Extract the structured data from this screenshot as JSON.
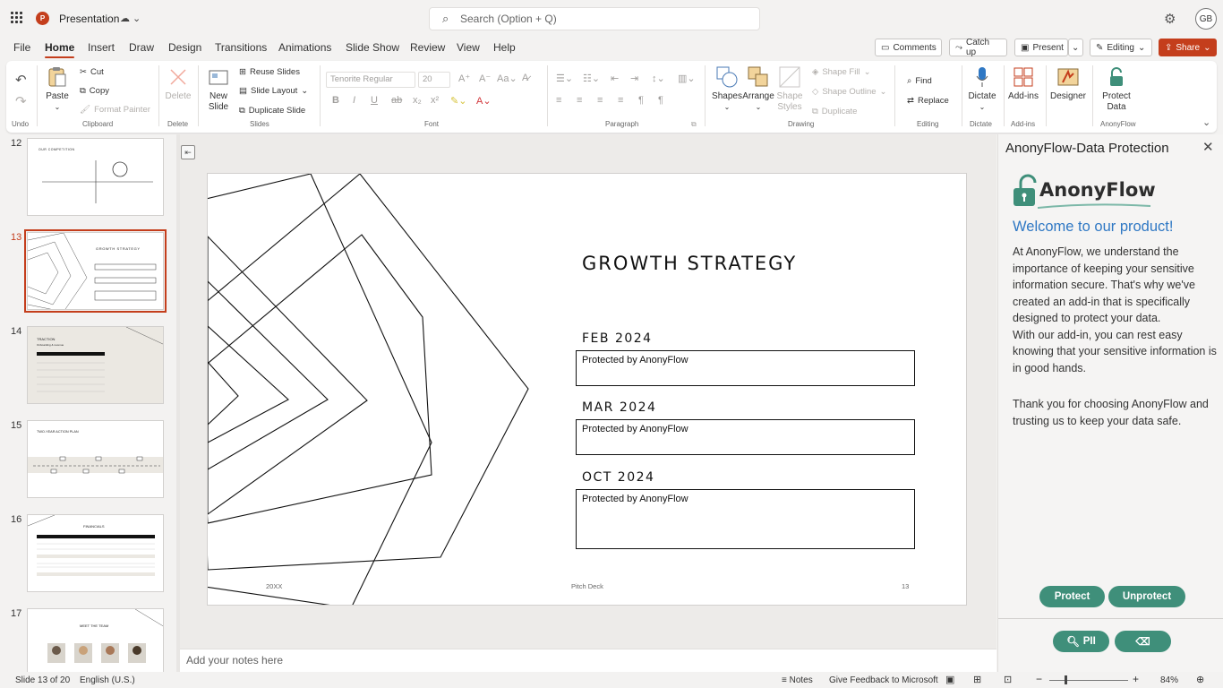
{
  "titlebar": {
    "app_icon_letter": "P",
    "doc_title": "Presentation",
    "sync_status": "☁︎ ⌄",
    "search_placeholder": "Search (Option + Q)",
    "user_initials": "GB"
  },
  "menu": {
    "tabs": [
      "File",
      "Home",
      "Insert",
      "Draw",
      "Design",
      "Transitions",
      "Animations",
      "Slide Show",
      "Review",
      "View",
      "Help"
    ],
    "active_tab": "Home",
    "comments": "Comments",
    "catch_up": "Catch up",
    "present": "Present",
    "editing": "Editing",
    "share": "Share"
  },
  "ribbon": {
    "undo_group": "Undo",
    "clipboard": {
      "paste": "Paste",
      "cut": "Cut",
      "copy": "Copy",
      "format_painter": "Format Painter",
      "label": "Clipboard"
    },
    "delete": {
      "delete": "Delete",
      "label": "Delete"
    },
    "slides": {
      "new_slide": "New Slide",
      "reuse": "Reuse Slides",
      "layout": "Slide Layout",
      "duplicate": "Duplicate Slide",
      "label": "Slides"
    },
    "font": {
      "name": "Tenorite Regular",
      "size": "20",
      "label": "Font"
    },
    "paragraph": {
      "label": "Paragraph"
    },
    "drawing": {
      "shapes": "Shapes",
      "arrange": "Arrange",
      "styles": "Shape Styles",
      "fill": "Shape Fill",
      "outline": "Shape Outline",
      "duplicate": "Duplicate",
      "label": "Drawing"
    },
    "editing": {
      "find": "Find",
      "replace": "Replace",
      "label": "Editing"
    },
    "dictate": {
      "dictate": "Dictate",
      "label": "Dictate"
    },
    "addins": {
      "addins": "Add-ins",
      "label": "Add-ins"
    },
    "designer": "Designer",
    "anonyflow": {
      "protect_data": "Protect Data",
      "label": "AnonyFlow"
    }
  },
  "slides_panel": {
    "thumbs": [
      {
        "num": "12",
        "title": "OUR COMPETITION"
      },
      {
        "num": "13",
        "title": "GROWTH STRATEGY"
      },
      {
        "num": "14",
        "title": "TRACTION",
        "subtitle": "Onboarding & revenue"
      },
      {
        "num": "15",
        "title": "TWO-YEAR ACTION PLAN"
      },
      {
        "num": "16",
        "title": "FINANCIALS"
      },
      {
        "num": "17",
        "title": "MEET THE TEAM"
      }
    ],
    "active": "13"
  },
  "slide": {
    "title": "GROWTH STRATEGY",
    "items": [
      {
        "heading": "FEB 2024",
        "text": "Protected by AnonyFlow"
      },
      {
        "heading": "MAR 2024",
        "text": "Protected by AnonyFlow"
      },
      {
        "heading": "OCT 2024",
        "text": "Protected by AnonyFlow"
      }
    ],
    "footer_left": "20XX",
    "footer_center": "Pitch Deck",
    "footer_right": "13"
  },
  "notes_placeholder": "Add your notes here",
  "taskpane": {
    "title": "AnonyFlow-Data Protection",
    "logo_text": "AnonyFlow",
    "welcome": "Welcome to our product!",
    "body_1": "At AnonyFlow, we understand the importance of keeping your sensitive information secure. That's why we've created an add-in that is specifically designed to protect your data.",
    "body_2": "With our add-in, you can rest easy knowing that your sensitive information is in good hands.",
    "thanks": "Thank you for choosing AnonyFlow and trusting us to keep your data safe.",
    "protect": "Protect",
    "unprotect": "Unprotect",
    "pii": "PII",
    "accent_color": "#3f8f7a"
  },
  "status": {
    "slide_count": "Slide 13 of 20",
    "language": "English (U.S.)",
    "notes": "Notes",
    "feedback": "Give Feedback to Microsoft",
    "zoom": "84%"
  }
}
